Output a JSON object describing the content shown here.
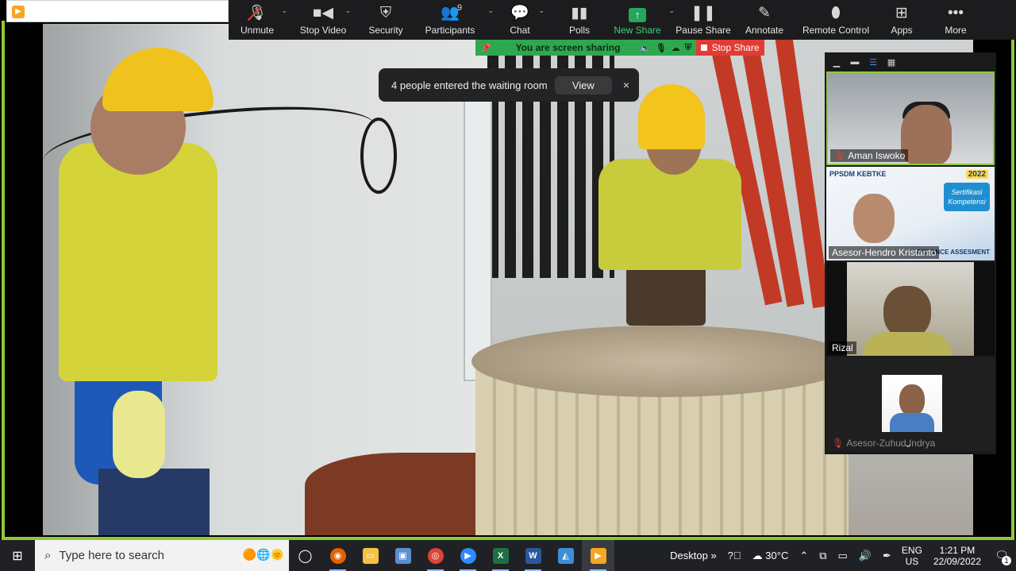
{
  "toolbar": {
    "items": [
      {
        "label": "Unmute",
        "icon": "microphone-muted-icon"
      },
      {
        "label": "Stop Video",
        "icon": "video-camera-icon"
      },
      {
        "label": "Security",
        "icon": "shield-icon"
      },
      {
        "label": "Participants",
        "icon": "participants-icon",
        "count": "9"
      },
      {
        "label": "Chat",
        "icon": "chat-bubble-icon"
      },
      {
        "label": "Polls",
        "icon": "bar-chart-icon"
      },
      {
        "label": "New Share",
        "icon": "share-arrow-icon"
      },
      {
        "label": "Pause Share",
        "icon": "pause-icon"
      },
      {
        "label": "Annotate",
        "icon": "pencil-icon"
      },
      {
        "label": "Remote Control",
        "icon": "mouse-icon"
      },
      {
        "label": "Apps",
        "icon": "apps-icon"
      },
      {
        "label": "More",
        "icon": "more-dots-icon"
      }
    ]
  },
  "share_bar": {
    "status": "You are screen sharing",
    "stop_label": "Stop Share"
  },
  "toast": {
    "message": "4 people entered the waiting room",
    "view_label": "View",
    "close_glyph": "×"
  },
  "gallery": {
    "participants": [
      {
        "name": "Aman Iswoko",
        "muted": true
      },
      {
        "name": "Asesor-Hendro Kristanto",
        "muted": false
      },
      {
        "name": "Rizal",
        "muted": false
      },
      {
        "name": "Asesor-Zuhud Indrya",
        "muted": true
      }
    ],
    "tile2_logo": "PPSDM KEBTKE",
    "tile2_year": "2022",
    "tile2_card": "Sertifikasi Kompetensi",
    "tile2_badge": "DISTANCE ASSESMENT"
  },
  "taskbar": {
    "search_placeholder": "Type here to search",
    "desktop_label": "Desktop",
    "weather": "30°C",
    "lang_top": "ENG",
    "lang_bottom": "US",
    "time": "1:21 PM",
    "date": "22/09/2022",
    "notification_count": "1"
  },
  "colors": {
    "share_green": "#2ea84e",
    "stop_red": "#e23b33",
    "frame_green": "#8fc83a",
    "toolbar_bg": "#1c1c1e"
  }
}
